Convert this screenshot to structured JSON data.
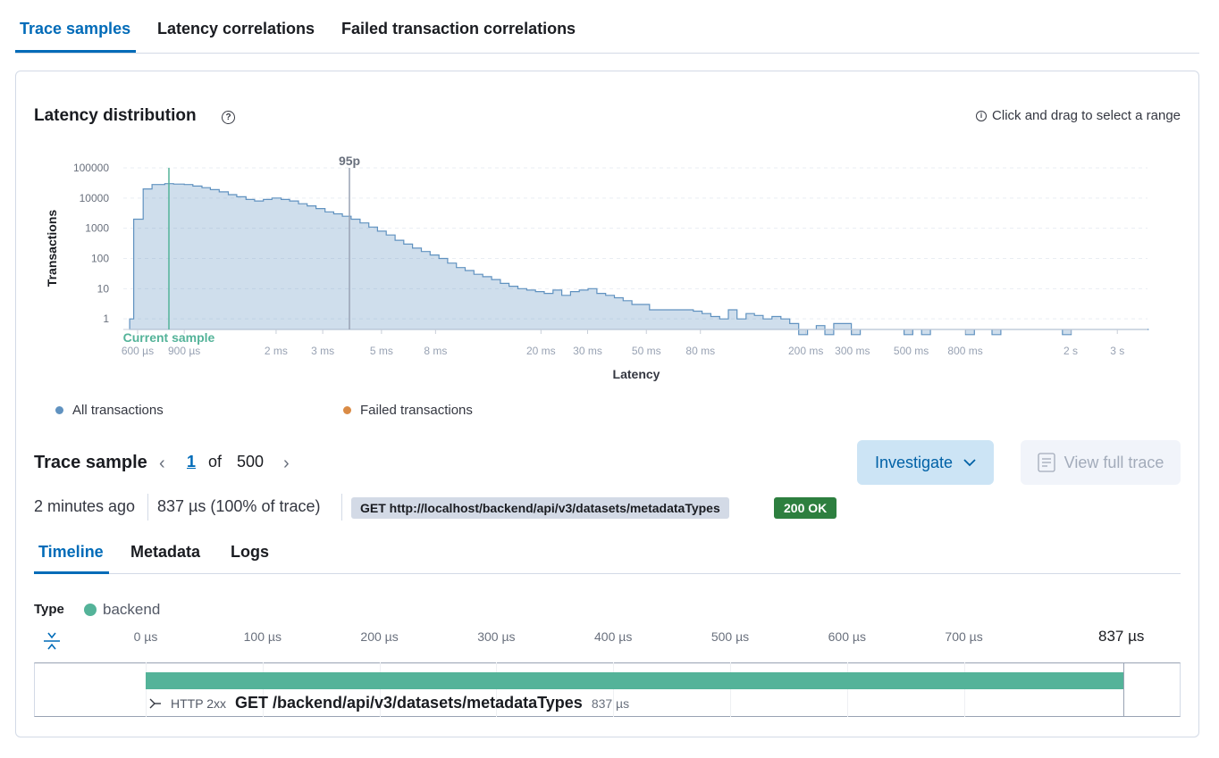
{
  "top_tabs": [
    {
      "label": "Trace samples",
      "active": true
    },
    {
      "label": "Latency correlations",
      "active": false
    },
    {
      "label": "Failed transaction correlations",
      "active": false
    }
  ],
  "latency": {
    "title": "Latency distribution",
    "hint": "Click and drag to select a range"
  },
  "chart_data": {
    "type": "area",
    "title": "",
    "xlabel": "Latency",
    "ylabel": "Transactions",
    "y_scale": "log",
    "y_ticks": [
      "100000",
      "10000",
      "1000",
      "100",
      "10",
      "1"
    ],
    "x_scale": "log",
    "x_ticks": [
      "600 µs",
      "900 µs",
      "2 ms",
      "3 ms",
      "5 ms",
      "8 ms",
      "20 ms",
      "30 ms",
      "50 ms",
      "80 ms",
      "200 ms",
      "300 ms",
      "500 ms",
      "800 ms",
      "2 s",
      "3 s"
    ],
    "annotations": {
      "percentile_label": "95p",
      "current_sample_label": "Current sample"
    },
    "series": [
      {
        "name": "All transactions",
        "color": "#6092c0",
        "bins": [
          [
            560,
            1
          ],
          [
            580,
            2000
          ],
          [
            630,
            20000
          ],
          [
            680,
            28000
          ],
          [
            760,
            30000
          ],
          [
            820,
            29000
          ],
          [
            900,
            28000
          ],
          [
            970,
            25000
          ],
          [
            1050,
            22000
          ],
          [
            1130,
            19000
          ],
          [
            1220,
            16000
          ],
          [
            1320,
            13000
          ],
          [
            1420,
            11000
          ],
          [
            1540,
            9000
          ],
          [
            1660,
            8000
          ],
          [
            1790,
            9000
          ],
          [
            1930,
            10000
          ],
          [
            2090,
            9000
          ],
          [
            2250,
            8000
          ],
          [
            2430,
            6500
          ],
          [
            2620,
            5500
          ],
          [
            2830,
            4500
          ],
          [
            3060,
            3500
          ],
          [
            3300,
            3000
          ],
          [
            3560,
            2500
          ],
          [
            3840,
            2000
          ],
          [
            4150,
            1500
          ],
          [
            4480,
            1100
          ],
          [
            4830,
            800
          ],
          [
            5210,
            600
          ],
          [
            5630,
            400
          ],
          [
            6070,
            300
          ],
          [
            6550,
            220
          ],
          [
            7070,
            170
          ],
          [
            7630,
            130
          ],
          [
            8240,
            100
          ],
          [
            8890,
            70
          ],
          [
            9590,
            50
          ],
          [
            10350,
            40
          ],
          [
            11170,
            30
          ],
          [
            12060,
            25
          ],
          [
            13020,
            20
          ],
          [
            14050,
            15
          ],
          [
            15160,
            12
          ],
          [
            16370,
            10
          ],
          [
            17670,
            9
          ],
          [
            19070,
            8
          ],
          [
            20580,
            7
          ],
          [
            22210,
            9
          ],
          [
            23970,
            6
          ],
          [
            25870,
            8
          ],
          [
            27920,
            9
          ],
          [
            30130,
            10
          ],
          [
            32520,
            7
          ],
          [
            35100,
            6
          ],
          [
            37880,
            5
          ],
          [
            40880,
            4
          ],
          [
            44120,
            3
          ],
          [
            47620,
            3
          ],
          [
            51390,
            2
          ],
          [
            55460,
            2
          ],
          [
            59850,
            2
          ],
          [
            64590,
            2
          ],
          [
            69710,
            2
          ],
          [
            75230,
            1.8
          ],
          [
            81190,
            1.5
          ],
          [
            87620,
            1.2
          ],
          [
            94560,
            1
          ],
          [
            102000,
            2
          ],
          [
            110000,
            1
          ],
          [
            119000,
            1.5
          ],
          [
            128000,
            1.3
          ],
          [
            138000,
            1
          ],
          [
            149000,
            1.2
          ],
          [
            161000,
            1
          ],
          [
            174000,
            0.7
          ],
          [
            188000,
            0.3
          ],
          [
            203000,
            0.05
          ],
          [
            219000,
            0.6
          ],
          [
            236000,
            0.3
          ],
          [
            255000,
            0.7
          ],
          [
            275000,
            0.7
          ],
          [
            297000,
            0.2
          ],
          [
            321000,
            0.05
          ],
          [
            347000,
            0.01
          ],
          [
            374000,
            0.01
          ],
          [
            404000,
            0.01
          ],
          [
            436000,
            0.01
          ],
          [
            470000,
            0.3
          ],
          [
            507000,
            0.01
          ],
          [
            547000,
            0.3
          ],
          [
            591000,
            0.01
          ],
          [
            638000,
            0.01
          ],
          [
            689000,
            0.01
          ],
          [
            743000,
            0.01
          ],
          [
            802000,
            0.2
          ],
          [
            866000,
            0.01
          ],
          [
            935000,
            0.01
          ],
          [
            1009000,
            0.1
          ],
          [
            1090000,
            0.01
          ],
          [
            1176000,
            0.01
          ],
          [
            1270000,
            0.01
          ],
          [
            1370000,
            0.01
          ],
          [
            1480000,
            0.01
          ],
          [
            1597000,
            0.01
          ],
          [
            1724000,
            0.01
          ],
          [
            1861000,
            0.3
          ],
          [
            2009000,
            0.01
          ],
          [
            2169000,
            0.01
          ],
          [
            2341000,
            0.01
          ],
          [
            2527000,
            0.01
          ],
          [
            2728000,
            0.01
          ],
          [
            2945000,
            0.01
          ],
          [
            3179000,
            0.01
          ],
          [
            3431000,
            0.01
          ],
          [
            3704000,
            0.01
          ]
        ]
      }
    ]
  },
  "legend": [
    {
      "label": "All transactions",
      "color": "#6092c0"
    },
    {
      "label": "Failed transactions",
      "color": "#da8b45"
    }
  ],
  "trace_sample": {
    "title": "Trace sample",
    "page_current": "1",
    "page_of": "of",
    "page_total": "500",
    "investigate_label": "Investigate",
    "view_full_trace_label": "View full trace",
    "time_ago": "2 minutes ago",
    "duration": "837 µs (100% of trace)",
    "url_badge": "GET http://localhost/backend/api/v3/datasets/metadataTypes",
    "status_badge": "200 OK"
  },
  "sub_tabs": [
    {
      "label": "Timeline",
      "active": true
    },
    {
      "label": "Metadata",
      "active": false
    },
    {
      "label": "Logs",
      "active": false
    }
  ],
  "timeline": {
    "type_label": "Type",
    "type_value": "backend",
    "type_color": "#54b399",
    "ticks": [
      "0 µs",
      "100 µs",
      "200 µs",
      "300 µs",
      "400 µs",
      "500 µs",
      "600 µs",
      "700 µs"
    ],
    "end_label": "837 µs",
    "span_status": "HTTP 2xx",
    "span_name": "GET /backend/api/v3/datasets/metadataTypes",
    "span_duration": "837 µs"
  }
}
